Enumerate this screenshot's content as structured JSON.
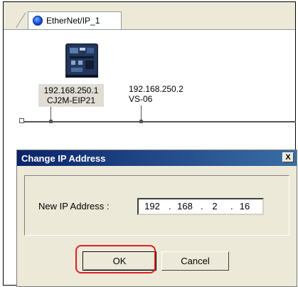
{
  "tab": {
    "label": "EtherNet/IP_1",
    "icon": "network-globe-icon"
  },
  "nodes": [
    {
      "ip": "192.168.250.1",
      "name": "CJ2M-EIP21",
      "icon": "plc-module-icon"
    },
    {
      "ip": "192.168.250.2",
      "name": "VS-06"
    }
  ],
  "dialog": {
    "title": "Change IP Address",
    "close_label": "X",
    "field_label": "New IP Address :",
    "ip_octets": [
      "192",
      "168",
      "2",
      "16"
    ],
    "separator": ".",
    "ok_label": "OK",
    "cancel_label": "Cancel"
  },
  "colors": {
    "titlebar": "#0a246a",
    "highlight": "#e02020",
    "dialog_bg": "#ece9d8"
  }
}
